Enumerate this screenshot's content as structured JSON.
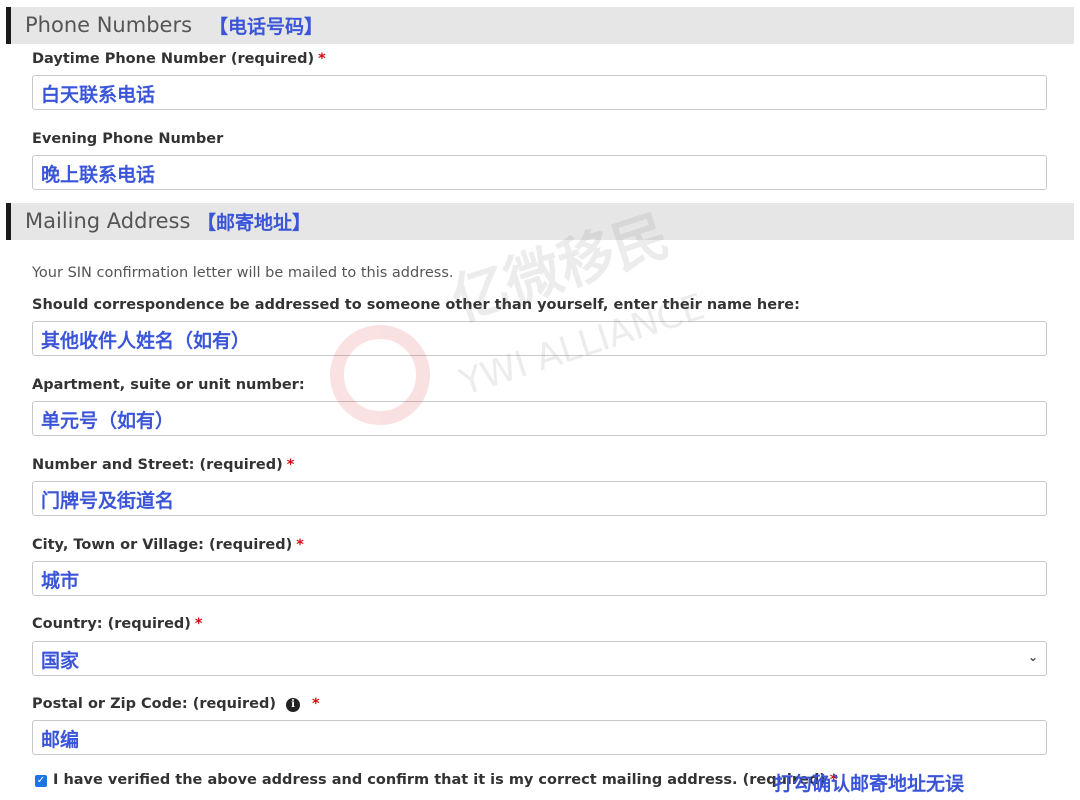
{
  "phone_section": {
    "title": "Phone Numbers",
    "annotation": "【电话号码】",
    "daytime": {
      "label": "Daytime Phone Number (required)",
      "required_mark": "*",
      "value": "白天联系电话"
    },
    "evening": {
      "label": "Evening Phone Number",
      "value": "晚上联系电话"
    }
  },
  "mailing_section": {
    "title": "Mailing Address",
    "annotation": "【邮寄地址】",
    "helper": "Your SIN confirmation letter will be mailed to this address.",
    "recipient": {
      "label": "Should correspondence be addressed to someone other than yourself, enter their name here:",
      "value": "其他收件人姓名（如有）"
    },
    "apartment": {
      "label": "Apartment, suite or unit number:",
      "value": "单元号（如有）"
    },
    "street": {
      "label": "Number and Street: (required)",
      "required_mark": "*",
      "value": "门牌号及街道名"
    },
    "city": {
      "label": "City, Town or Village: (required)",
      "required_mark": "*",
      "value": "城市"
    },
    "country": {
      "label": "Country: (required)",
      "required_mark": "*",
      "value": "国家"
    },
    "postal": {
      "label": "Postal or Zip Code: (required)",
      "info_icon": "i",
      "required_mark": "*",
      "value": "邮编"
    },
    "verify": {
      "checked": true,
      "label": "I have verified the above address and confirm that it is my correct mailing address. (required)",
      "required_mark": "*",
      "annotation": "打勾确认邮寄地址无误"
    }
  },
  "watermark": {
    "brand_cn": "亿微移民",
    "brand_en": "YWI ALLIANCE"
  },
  "colors": {
    "annotation_blue": "#3b55d9",
    "required_red": "#d3080c",
    "header_bg": "#e6e6e6",
    "checkbox_blue": "#1a73e8"
  }
}
